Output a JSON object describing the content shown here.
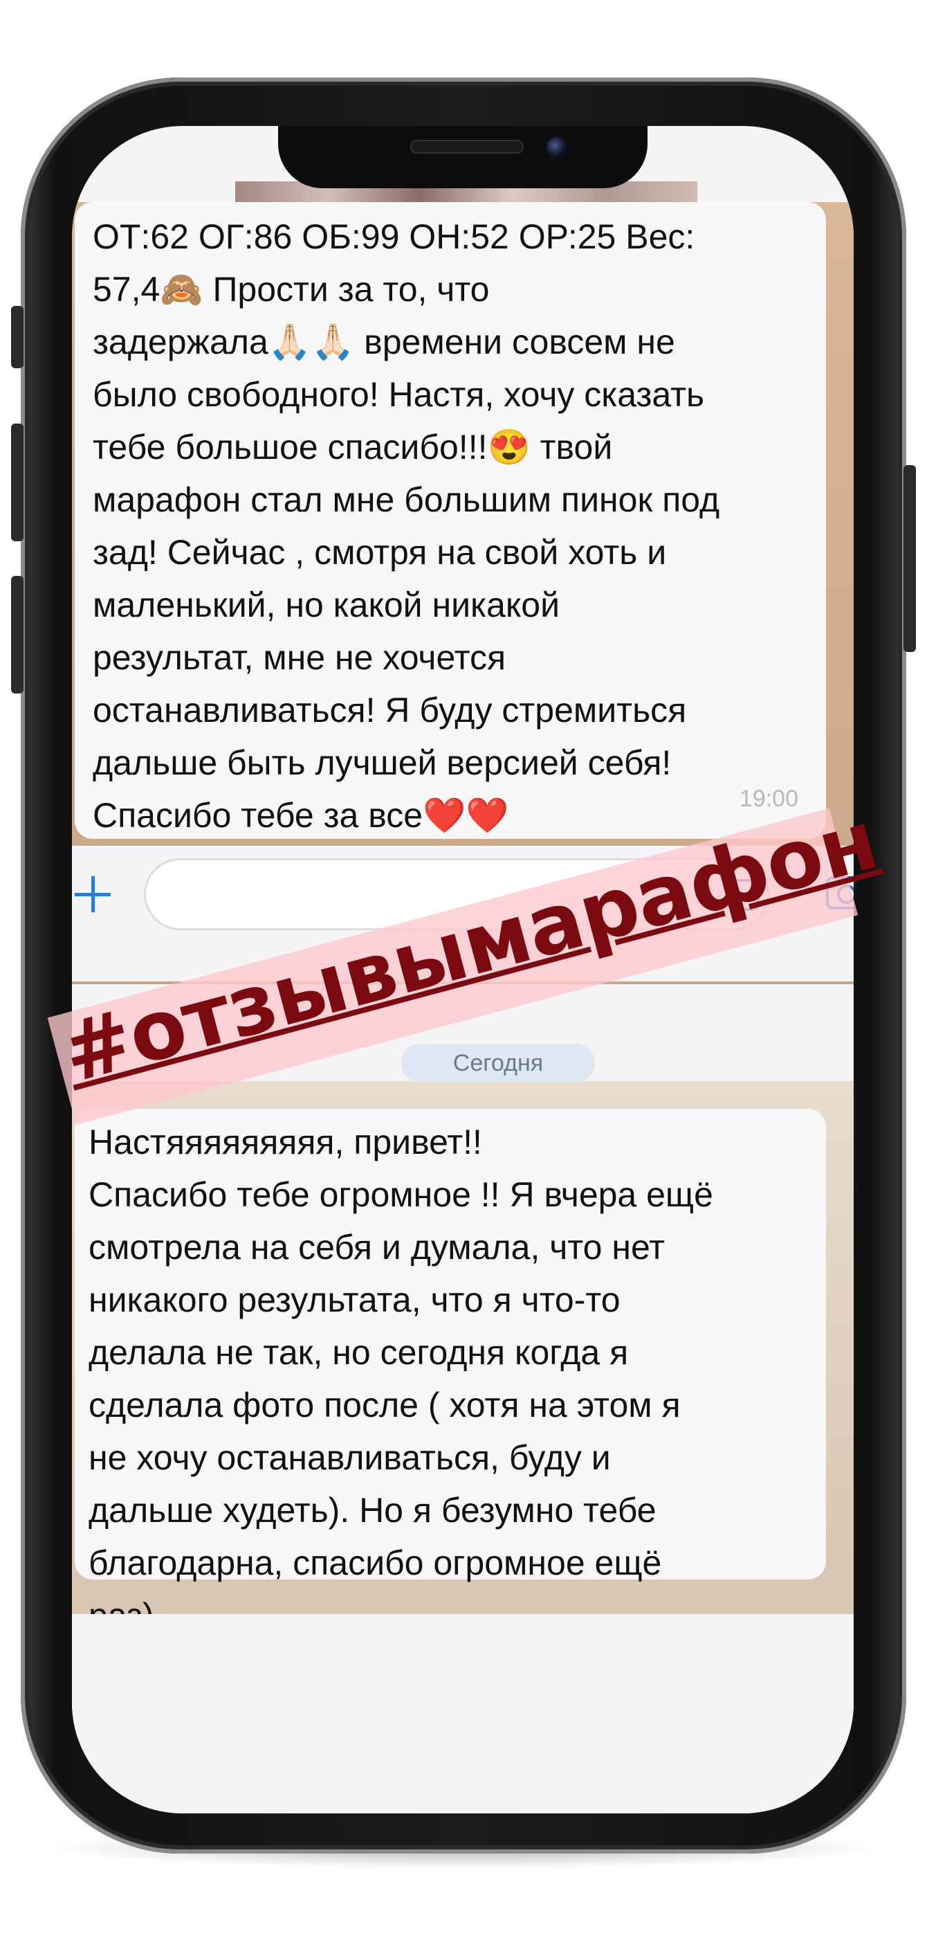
{
  "message_1": {
    "text": "ОТ:62 ОГ:86 ОБ:99 ОН:52 ОР:25 Вес:\n57,4🙈 Прости за то, что\nзадержала🙏🏻🙏🏻 времени совсем не\nбыло свободного! Настя, хочу сказать\nтебе большое спасибо!!!😍 твой\nмарафон стал мне большим пинок под\nзад! Сейчас , смотря на свой хоть и\nмаленький, но какой никакой\nрезультат, мне не хочется\nостанавливаться! Я буду стремиться\nдальше быть лучшей версией себя!\nСпасибо тебе за все❤️❤️",
    "time": "19:00"
  },
  "date_separator": "Сегодня",
  "message_2": {
    "text": "Настяяяяяяяяя, привет!!\nСпасибо тебе огромное !! Я вчера ещё\nсмотрела на себя и думала, что нет\nникакого результата, что я что-то\nделала не так, но сегодня когда я\nсделала фото после ( хотя на этом я\nне хочу останавливаться, буду и\nдальше худеть). Но я безумно тебе\nблагодарна, спасибо огромное ещё\nраз)"
  },
  "hashtag": "#отзывымарафон",
  "icons": {
    "attach": "plus-icon",
    "sticker": "sticker-icon",
    "camera": "camera-icon"
  },
  "colors": {
    "hashtag_text": "#7a0a0f",
    "hashtag_band": "#ffc8cd",
    "ios_blue": "#2a7bd8"
  }
}
